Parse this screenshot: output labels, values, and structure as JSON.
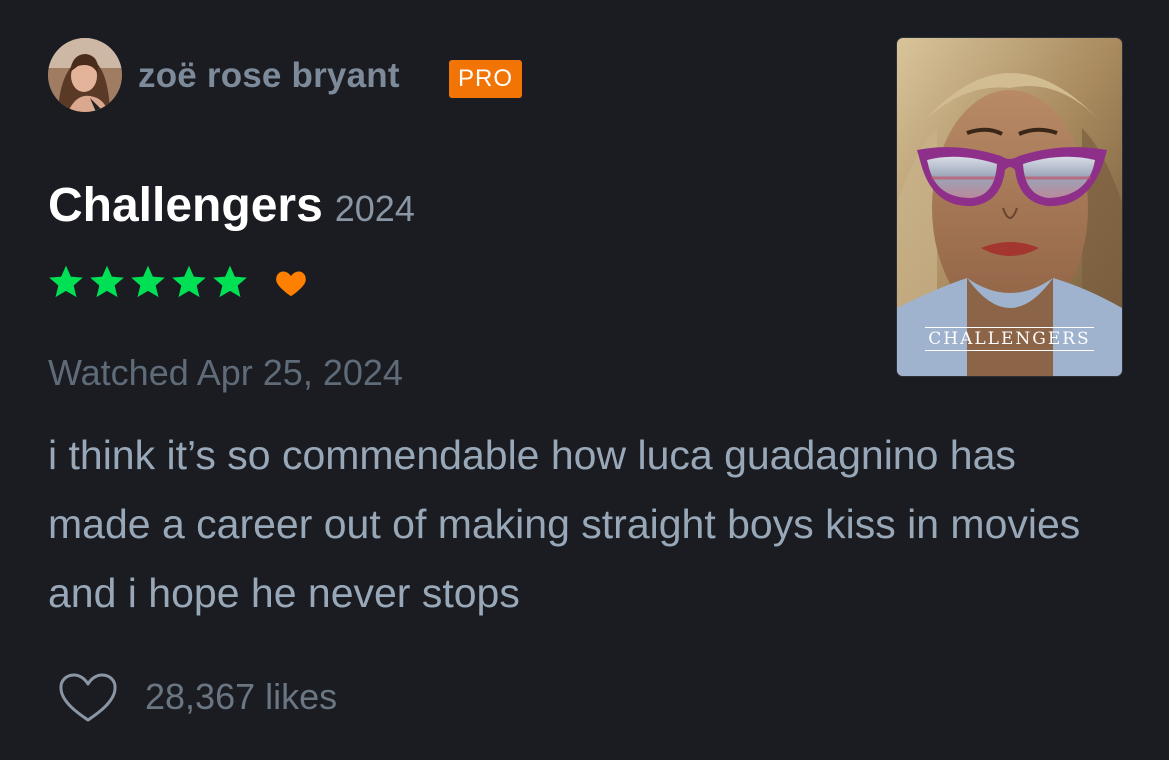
{
  "user": {
    "name": "zoë rose bryant",
    "badge": "PRO"
  },
  "film": {
    "title": "Challengers",
    "year": "2024",
    "rating_stars": 5,
    "rating_max": 5,
    "liked": true,
    "poster_title": "CHALLENGERS"
  },
  "watched": "Watched Apr 25, 2024",
  "review": "i think it’s so commendable how luca guadagnino has made a career out of making straight boys kiss in movies and i hope he never stops",
  "likes": "28,367 likes",
  "colors": {
    "background": "#1a1c21",
    "star": "#00e054",
    "heart": "#ff8000",
    "badge": "#f27405"
  }
}
